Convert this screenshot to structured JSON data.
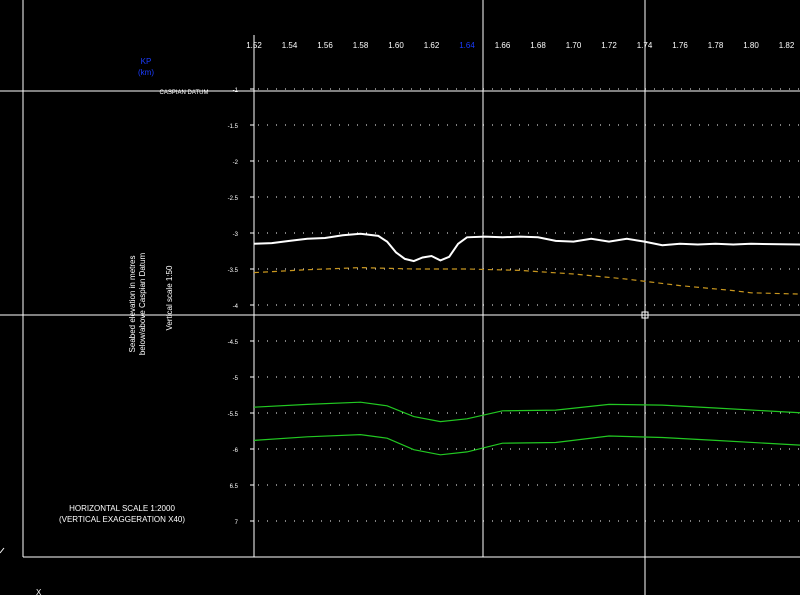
{
  "app": {
    "kp_label": "KP",
    "kp_unit": "(km)",
    "datum_label": "CASPIAN DATUM",
    "y_axis_title_line1": "Seabed elevation in metres",
    "y_axis_title_line2": "below/above Caspian Datum",
    "vertical_scale": "Vertical scale 1:50",
    "horizontal_scale": "HORIZONTAL SCALE 1:2000",
    "vertical_exaggeration": "(VERTICAL EXAGGERATION X40)",
    "cursor_marker": "X"
  },
  "chart_data": {
    "type": "line",
    "x_ticks": [
      "1.52",
      "1.54",
      "1.56",
      "1.58",
      "1.60",
      "1.62",
      "1.64",
      "1.66",
      "1.68",
      "1.70",
      "1.72",
      "1.74",
      "1.76",
      "1.78",
      "1.80",
      "1.82"
    ],
    "y_ticks": [
      "-1",
      "-1.5",
      "-2",
      "-2.5",
      "-3",
      "-3.5",
      "-4",
      "-4.5",
      "-5",
      "-5.5",
      "-6",
      "6.5",
      "7"
    ],
    "xlim": [
      1.52,
      1.83
    ],
    "ylim": [
      -1,
      -7
    ],
    "highlighted_tick": "1.64",
    "grid": "dotted",
    "series": [
      {
        "color": "#ffffff",
        "style": "solid",
        "points": [
          [
            1.52,
            -3.15
          ],
          [
            1.53,
            -3.14
          ],
          [
            1.54,
            -3.11
          ],
          [
            1.55,
            -3.08
          ],
          [
            1.56,
            -3.07
          ],
          [
            1.57,
            -3.03
          ],
          [
            1.58,
            -3.01
          ],
          [
            1.59,
            -3.04
          ],
          [
            1.595,
            -3.12
          ],
          [
            1.6,
            -3.27
          ],
          [
            1.605,
            -3.36
          ],
          [
            1.61,
            -3.39
          ],
          [
            1.615,
            -3.34
          ],
          [
            1.62,
            -3.32
          ],
          [
            1.625,
            -3.38
          ],
          [
            1.63,
            -3.33
          ],
          [
            1.635,
            -3.15
          ],
          [
            1.64,
            -3.06
          ],
          [
            1.65,
            -3.05
          ],
          [
            1.66,
            -3.06
          ],
          [
            1.67,
            -3.05
          ],
          [
            1.68,
            -3.06
          ],
          [
            1.69,
            -3.11
          ],
          [
            1.7,
            -3.12
          ],
          [
            1.71,
            -3.08
          ],
          [
            1.72,
            -3.12
          ],
          [
            1.73,
            -3.08
          ],
          [
            1.74,
            -3.12
          ],
          [
            1.75,
            -3.17
          ],
          [
            1.76,
            -3.15
          ],
          [
            1.77,
            -3.16
          ],
          [
            1.78,
            -3.15
          ],
          [
            1.79,
            -3.16
          ],
          [
            1.8,
            -3.15
          ],
          [
            1.83,
            -3.16
          ]
        ]
      },
      {
        "color": "#c8961e",
        "style": "dashed",
        "points": [
          [
            1.52,
            -3.55
          ],
          [
            1.55,
            -3.51
          ],
          [
            1.58,
            -3.48
          ],
          [
            1.61,
            -3.5
          ],
          [
            1.64,
            -3.5
          ],
          [
            1.67,
            -3.52
          ],
          [
            1.7,
            -3.57
          ],
          [
            1.73,
            -3.64
          ],
          [
            1.76,
            -3.73
          ],
          [
            1.79,
            -3.8
          ],
          [
            1.8,
            -3.83
          ],
          [
            1.83,
            -3.85
          ]
        ]
      },
      {
        "color": "#22c822",
        "style": "solid",
        "points": [
          [
            1.52,
            -5.42
          ],
          [
            1.55,
            -5.38
          ],
          [
            1.58,
            -5.35
          ],
          [
            1.595,
            -5.4
          ],
          [
            1.61,
            -5.55
          ],
          [
            1.625,
            -5.62
          ],
          [
            1.64,
            -5.58
          ],
          [
            1.66,
            -5.47
          ],
          [
            1.69,
            -5.46
          ],
          [
            1.72,
            -5.38
          ],
          [
            1.75,
            -5.39
          ],
          [
            1.78,
            -5.43
          ],
          [
            1.83,
            -5.5
          ]
        ]
      },
      {
        "color": "#22c822",
        "style": "solid",
        "points": [
          [
            1.52,
            -5.88
          ],
          [
            1.55,
            -5.83
          ],
          [
            1.58,
            -5.8
          ],
          [
            1.595,
            -5.85
          ],
          [
            1.61,
            -6.01
          ],
          [
            1.625,
            -6.08
          ],
          [
            1.64,
            -6.04
          ],
          [
            1.66,
            -5.92
          ],
          [
            1.69,
            -5.91
          ],
          [
            1.72,
            -5.82
          ],
          [
            1.75,
            -5.84
          ],
          [
            1.78,
            -5.88
          ],
          [
            1.83,
            -5.95
          ]
        ]
      }
    ]
  }
}
